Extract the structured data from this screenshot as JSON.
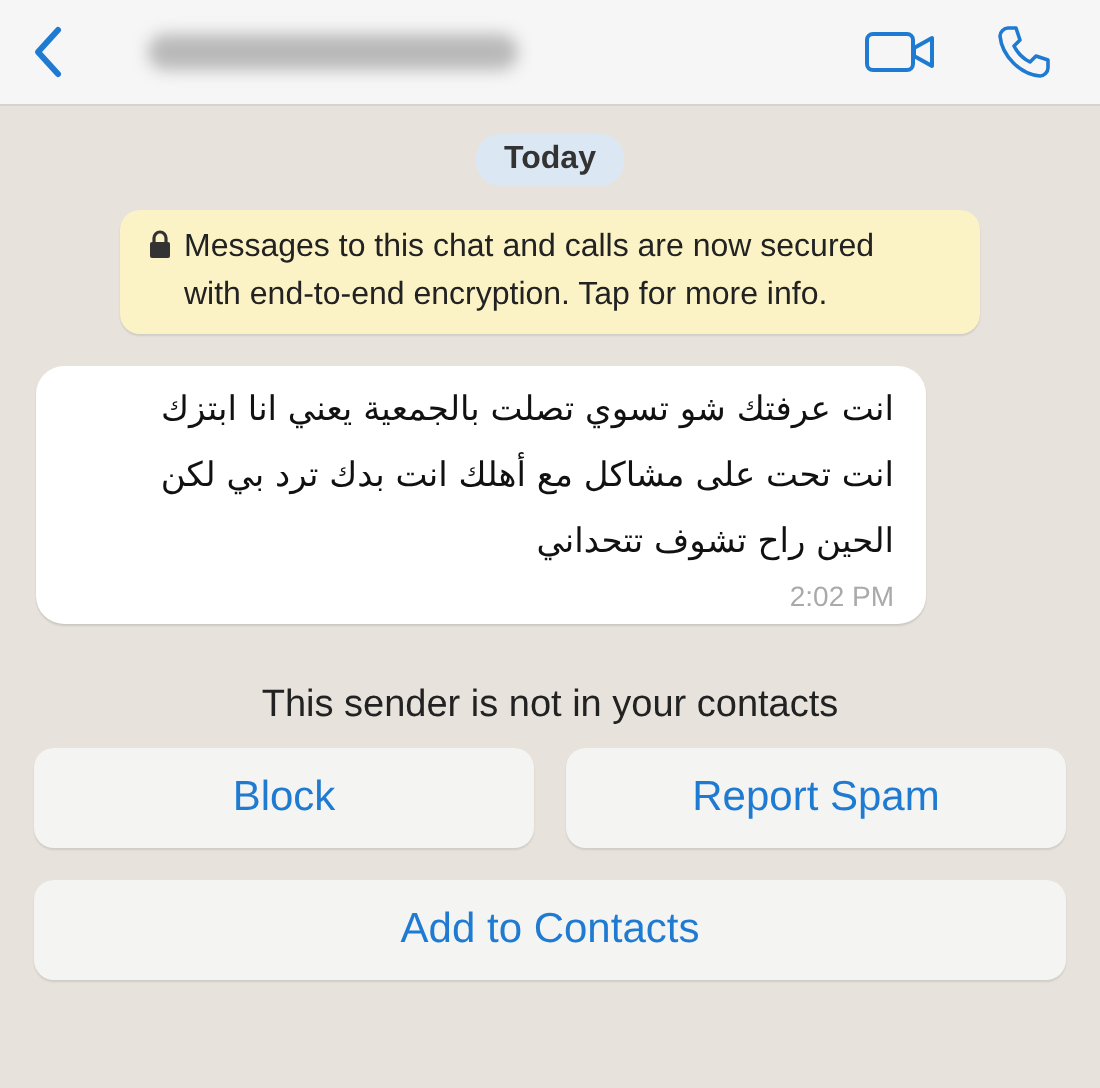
{
  "header": {
    "title_blurred": true
  },
  "date_pill": "Today",
  "notice": {
    "text": "Messages to this chat and calls are now secured with end-to-end encryption. Tap for more info."
  },
  "message": {
    "text": "انت عرفتك شو تسوي تصلت بالجمعية يعني انا ابتزك\nانت تحت على مشاكل مع أهلك انت بدك ترد بي لكن\nالحين راح تشوف تتحداني",
    "time": "2:02 PM"
  },
  "sender_notice": "This sender is not in your contacts",
  "actions": [
    {
      "label": "Block",
      "wide": false
    },
    {
      "label": "Report Spam",
      "wide": false
    },
    {
      "label": "Add to Contacts",
      "wide": true
    }
  ]
}
